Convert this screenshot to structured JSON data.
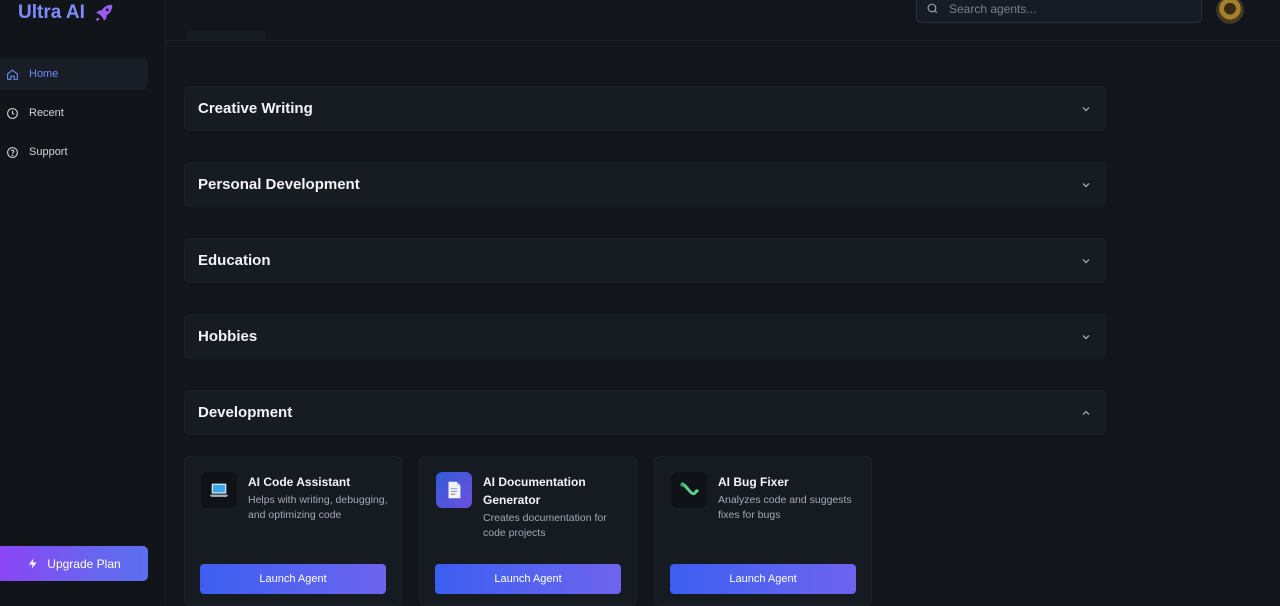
{
  "app": {
    "name": "Ultra AI"
  },
  "search": {
    "placeholder": "Search agents..."
  },
  "sidebar": {
    "items": [
      {
        "label": "Home",
        "icon": "home-icon",
        "active": true
      },
      {
        "label": "Recent",
        "icon": "clock-icon",
        "active": false
      },
      {
        "label": "Support",
        "icon": "help-circle-icon",
        "active": false
      }
    ],
    "upgrade_label": "Upgrade Plan"
  },
  "categories": [
    {
      "title": "Creative Writing",
      "expanded": false
    },
    {
      "title": "Personal Development",
      "expanded": false
    },
    {
      "title": "Education",
      "expanded": false
    },
    {
      "title": "Hobbies",
      "expanded": false
    },
    {
      "title": "Development",
      "expanded": true
    }
  ],
  "agents": [
    {
      "title": "AI Code Assistant",
      "description": "Helps with writing, debugging, and optimizing code",
      "icon": "laptop-icon",
      "button": "Launch Agent"
    },
    {
      "title": "AI Documentation Generator",
      "description": "Creates documentation for code projects",
      "icon": "document-icon",
      "button": "Launch Agent"
    },
    {
      "title": "AI Bug Fixer",
      "description": "Analyzes code and suggests fixes for bugs",
      "icon": "bug-icon",
      "button": "Launch Agent"
    }
  ],
  "colors": {
    "accent": "#5a63ef",
    "upgrade_gradient_start": "#8b46f5",
    "background": "#12151c"
  }
}
